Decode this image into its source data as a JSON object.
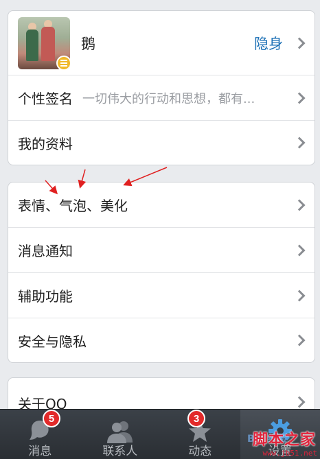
{
  "profile": {
    "nickname": "鹅",
    "status": "隐身"
  },
  "signature": {
    "label": "个性签名",
    "value": "一切伟大的行动和思想，都有..."
  },
  "my_info": {
    "label": "我的资料"
  },
  "settings": [
    {
      "label": "表情、气泡、美化"
    },
    {
      "label": "消息通知"
    },
    {
      "label": "辅助功能"
    },
    {
      "label": "安全与隐私"
    }
  ],
  "about": {
    "label": "关于QQ"
  },
  "tabs": [
    {
      "label": "消息",
      "badge": "5",
      "icon": "chat-bubble-icon"
    },
    {
      "label": "联系人",
      "badge": "",
      "icon": "contacts-icon"
    },
    {
      "label": "动态",
      "badge": "3",
      "icon": "star-icon"
    },
    {
      "label": "设置",
      "badge": "",
      "icon": "gear-icon"
    }
  ],
  "watermark": {
    "title": "脚本之家",
    "url": "www.jb51.net",
    "baidu": "Bai 经验"
  },
  "colors": {
    "status_blue": "#1a6fb5",
    "badge_red": "#e22a2a",
    "annotation_red": "#e02020"
  }
}
